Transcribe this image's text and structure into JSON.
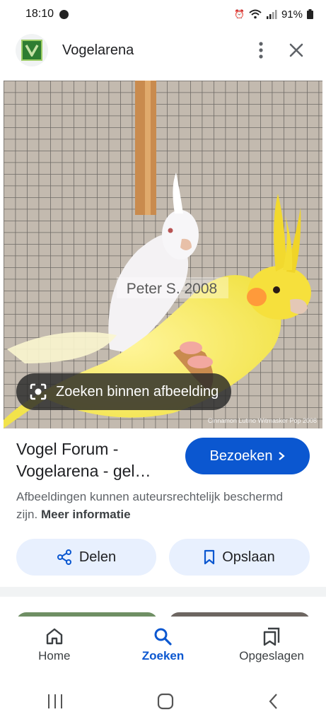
{
  "status_bar": {
    "time": "18:10",
    "battery": "91%"
  },
  "header": {
    "site_name": "Vogelarena"
  },
  "image": {
    "watermark": "Peter S. 2008",
    "caption": "Cinnamon Lutino Witmasker Pop 2008"
  },
  "lens": {
    "label": "Zoeken binnen afbeelding"
  },
  "result": {
    "title": "Vogel Forum - Vogelarena - gel…",
    "visit_label": "Bezoeken",
    "copyright_text": "Afbeeldingen kunnen auteursrechtelijk beschermd zijn.",
    "more_info_label": "Meer informatie"
  },
  "actions": {
    "share_label": "Delen",
    "save_label": "Opslaan"
  },
  "bottom_nav": {
    "home": "Home",
    "search": "Zoeken",
    "saved": "Opgeslagen"
  },
  "colors": {
    "accent": "#0b57d0",
    "action_bg": "#e8f0fe"
  },
  "icons": [
    "lens-icon",
    "share-icon",
    "bookmark-icon",
    "home-icon",
    "search-icon",
    "collections-icon",
    "more-icon",
    "close-icon"
  ]
}
